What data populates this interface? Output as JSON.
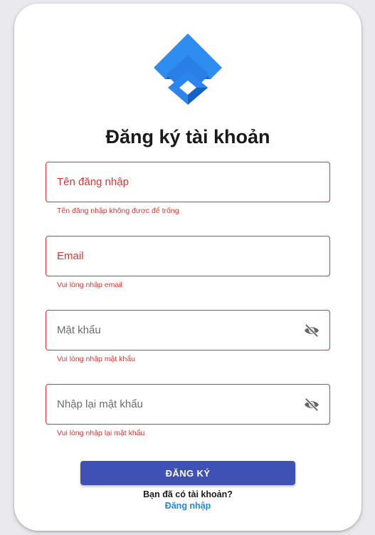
{
  "header": {
    "logo_icon": "stacked-diamond-logo",
    "title": "Đăng ký tài khoản"
  },
  "form": {
    "username": {
      "placeholder": "Tên đăng nhập",
      "value": "",
      "error": "Tên đăng nhập không được để trống"
    },
    "email": {
      "placeholder": "Email",
      "value": "",
      "error": "Vui lòng nhập email"
    },
    "password": {
      "placeholder": "Mật khẩu",
      "value": "",
      "error": "Vui lòng nhập mật khẩu",
      "toggle_icon": "eye-off-icon"
    },
    "confirm_password": {
      "placeholder": "Nhập lại mật khẩu",
      "value": "",
      "error": "Vui lòng nhập lại mật khẩu",
      "toggle_icon": "eye-off-icon"
    },
    "submit_label": "ĐĂNG KÝ"
  },
  "footer": {
    "prompt": "Bạn đã có tài khoản?",
    "login_link": "Đăng nhập"
  },
  "colors": {
    "error": "#d23a36",
    "primary_button": "#3f51b5",
    "link": "#1e88e5",
    "logo_light": "#42a5f5",
    "logo_dark": "#1565c0"
  }
}
